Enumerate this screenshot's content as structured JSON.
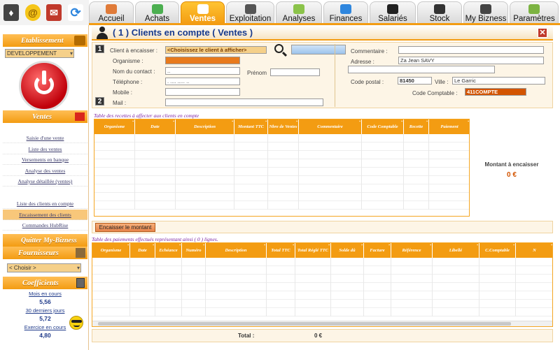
{
  "tabs": [
    {
      "label": "Accueil",
      "icon": "home-icon"
    },
    {
      "label": "Achats",
      "icon": "watermelon-icon"
    },
    {
      "label": "Ventes",
      "icon": "cup-icon"
    },
    {
      "label": "Exploitation",
      "icon": "tool-icon"
    },
    {
      "label": "Analyses",
      "icon": "chart-icon"
    },
    {
      "label": "Finances",
      "icon": "finance-icon"
    },
    {
      "label": "Salariés",
      "icon": "people-icon"
    },
    {
      "label": "Stock",
      "icon": "box-icon"
    },
    {
      "label": "My Bizness",
      "icon": "bizness-icon"
    },
    {
      "label": "Paramètres",
      "icon": "settings-icon"
    }
  ],
  "sidebar": {
    "etablissement_title": "Etablissement",
    "etablissement_value": "DEVELOPPEMENT",
    "ventes_title": "Ventes",
    "links": [
      "Saisie d'une vente",
      "Liste des ventes",
      "Versements en banque",
      "Analyse des ventes",
      "Analyse détaillée (ventes)"
    ],
    "links2": [
      "Liste des clients en compte",
      "Encaissement des clients",
      "Commandes HubRise"
    ],
    "quit": "Quitter My-Bizness",
    "fournisseurs_title": "Fournisseurs",
    "fournisseurs_select": "< Choisir >",
    "coef_title": "Coefficients",
    "coef": [
      {
        "label": "Mois en cours",
        "value": "5,56"
      },
      {
        "label": "30 derniers jours",
        "value": "5,72"
      },
      {
        "label": "Exercice en cours",
        "value": "4,80"
      }
    ]
  },
  "header": {
    "title": "( 1 ) Clients en compte ( Ventes )"
  },
  "form": {
    "client_label": "Client à encaisser :",
    "client_select": "<Choisissez le client à afficher>",
    "organisme_label": "Organisme :",
    "contact_label": "Nom du contact :",
    "contact_value": "..",
    "prenom_label": "Prénom",
    "telephone_label": "Téléphone :",
    "telephone_value": ". .... ..... ..",
    "mobile_label": "Mobile :",
    "mail_label": "Mail :",
    "commentaire_label": "Commentaire :",
    "adresse_label": "Adresse :",
    "adresse_value": "Za Jean SAVY",
    "cp_label": "Code postal :",
    "cp_value": "81450",
    "ville_label": "Ville :",
    "ville_value": "Le Garric",
    "code_comptable_label": "Code Comptable :",
    "code_comptable_value": "411COMPTE"
  },
  "recettes": {
    "caption": "Table des recettes à affecter aux clients en compte",
    "columns": [
      "Organisme",
      "Date",
      "Description",
      "Montant TTC",
      "Nbre de Ventes",
      "Commentaire",
      "Code Comptable",
      "Recette",
      "Paiement"
    ],
    "button": "Encaisser le montant"
  },
  "panel3": {
    "label": "Montant à encaisser",
    "value": "0 €"
  },
  "paiements": {
    "caption": "Table des paiements effectués représentant ainsi ( 0 ) lignes.",
    "columns": [
      "Organisme",
      "Date",
      "Echéance",
      "Numéro",
      "Description",
      "Total TTC",
      "Total Réglé TTC",
      "Solde dû",
      "Facture",
      "Référence",
      "Libellé",
      "C.Comptable",
      "N"
    ]
  },
  "total": {
    "label": "Total :",
    "value": "0 €"
  },
  "colors": {
    "accent": "#f39c12",
    "title": "#173a8e",
    "caption": "#7a1fa2",
    "code_comptable": "#d35400"
  }
}
